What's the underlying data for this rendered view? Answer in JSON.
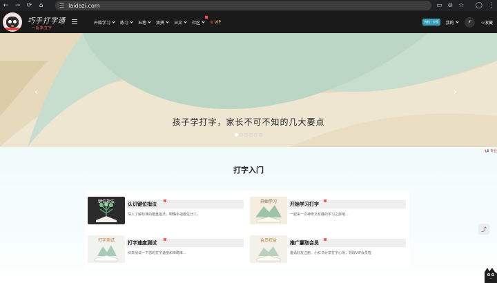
{
  "browser": {
    "url": "laidazi.com",
    "nav_icons": [
      "back-arrow-icon",
      "forward-arrow-icon",
      "reload-icon",
      "home-icon"
    ],
    "site_info_icon": "tune-icon",
    "right_icons": [
      "cast-icon",
      "zoom-icon",
      "star-icon",
      "profile-icon",
      "more-icon"
    ]
  },
  "header": {
    "brand_title": "巧手打字通",
    "brand_subtitle": "一起来打字",
    "nav": [
      {
        "label": "开始学习",
        "dropdown": true
      },
      {
        "label": "练习",
        "dropdown": true
      },
      {
        "label": "五笔",
        "dropdown": true
      },
      {
        "label": "双拼",
        "dropdown": true
      },
      {
        "label": "日文",
        "dropdown": true
      },
      {
        "label": "社区",
        "dropdown": true,
        "new_dot": true
      },
      {
        "label": "VIP",
        "dropdown": false,
        "icon": "crown-icon"
      }
    ],
    "badge": "有钱 · 卡顿",
    "my_menu": "我的",
    "favorite": "☆收藏"
  },
  "banner": {
    "headline": "孩子学打字，家长不可不知的几大要点",
    "slide_count": 6,
    "active_slide": 0,
    "colors": {
      "cream": "#efe6d1",
      "mint": "#c6ddcd",
      "deep": "#a9c7b8"
    }
  },
  "notice": "📢 专业",
  "section": {
    "title": "打字入门",
    "cards": [
      {
        "title": "认识键位指法",
        "desc": "深入了解标准的键盘指法，明确手指键位分工。",
        "thumb_label": "键位指法",
        "new_dot": true
      },
      {
        "title": "开始学习打字",
        "desc": "一起来一次神奇又有趣的学习之旅吧...",
        "thumb_label": "开始学习",
        "new_dot": true
      },
      {
        "title": "打字速度测试",
        "desc": "快来测试一下您的打字速度和准确率...",
        "thumb_label": "打字测试",
        "new_dot": true
      },
      {
        "title": "推广赢取会员",
        "desc": "邀请好友注册、小红书分享打字心得，领取VIP会员啦",
        "thumb_label": "会员权益",
        "new_dot": true
      }
    ]
  }
}
